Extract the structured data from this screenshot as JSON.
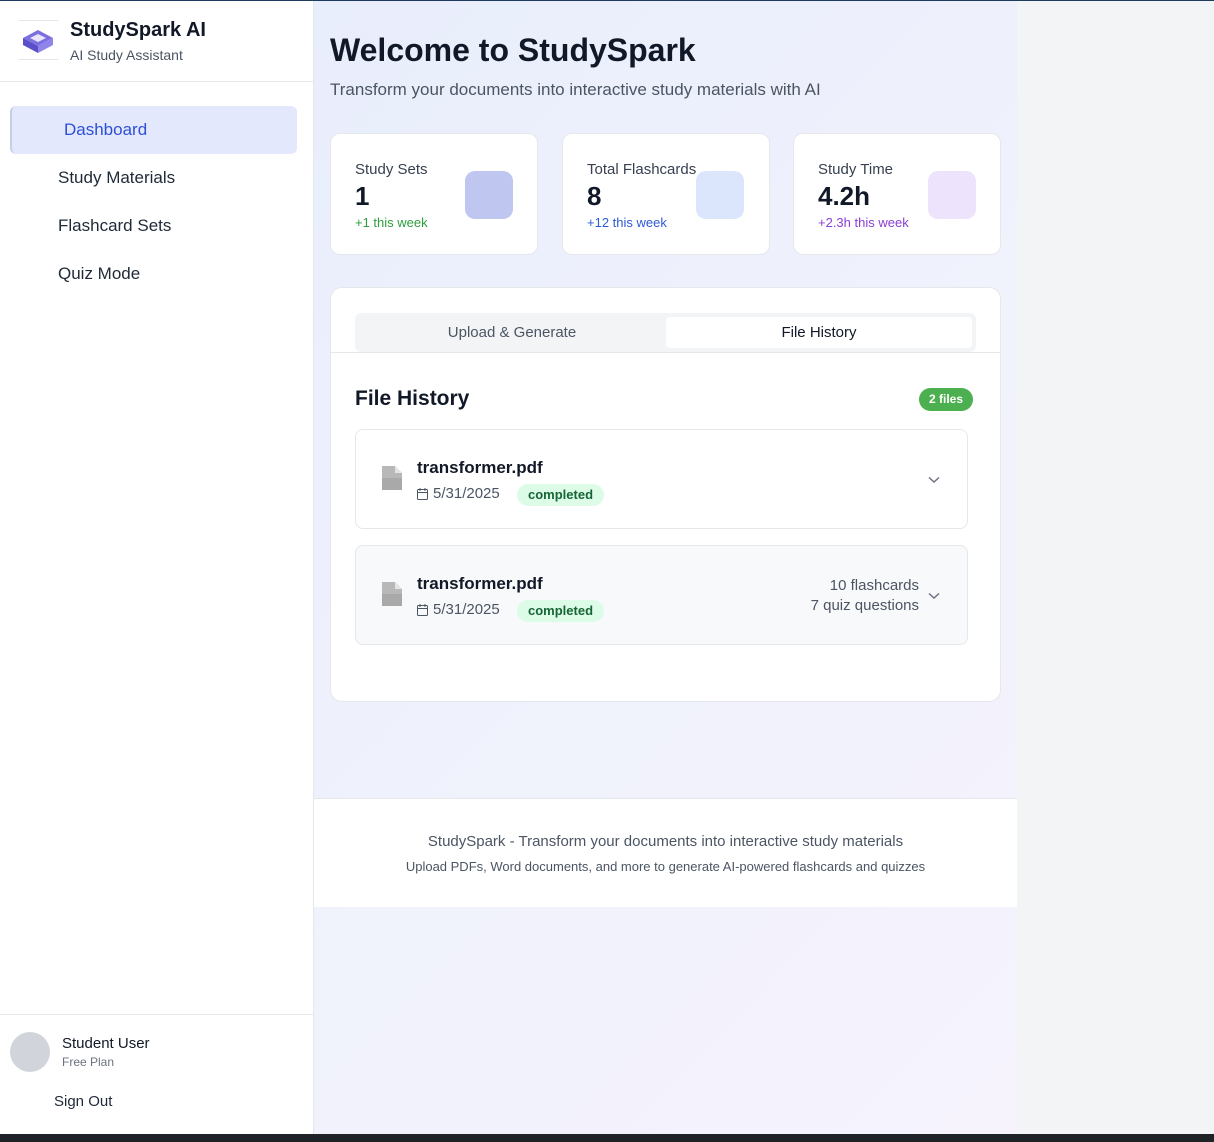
{
  "brand": {
    "title": "StudySpark AI",
    "subtitle": "AI Study Assistant",
    "logo_icon": "layers-icon"
  },
  "nav": {
    "items": [
      {
        "label": "Dashboard",
        "active": true
      },
      {
        "label": "Study Materials",
        "active": false
      },
      {
        "label": "Flashcard Sets",
        "active": false
      },
      {
        "label": "Quiz Mode",
        "active": false
      }
    ]
  },
  "user": {
    "name": "Student User",
    "plan": "Free Plan",
    "sign_out": "Sign Out"
  },
  "header": {
    "title": "Welcome to StudySpark",
    "subtitle": "Transform your documents into interactive study materials with AI"
  },
  "stats": [
    {
      "label": "Study Sets",
      "value": "1",
      "change": "+1 this week",
      "change_color": "#2e9e3e",
      "box_color": "#bfc6f0"
    },
    {
      "label": "Total Flashcards",
      "value": "8",
      "change": "+12 this week",
      "change_color": "#2d5bd6",
      "box_color": "#dbe6fd"
    },
    {
      "label": "Study Time",
      "value": "4.2h",
      "change": "+2.3h this week",
      "change_color": "#8b3fd6",
      "box_color": "#ede3fd"
    }
  ],
  "tabs": {
    "upload": "Upload & Generate",
    "history": "File History",
    "active": "history"
  },
  "file_history": {
    "title": "File History",
    "count_badge": "2 files",
    "files": [
      {
        "name": "transformer.pdf",
        "date": "5/31/2025",
        "status": "completed",
        "flashcards": "",
        "quiz": ""
      },
      {
        "name": "transformer.pdf",
        "date": "5/31/2025",
        "status": "completed",
        "flashcards": "10 flashcards",
        "quiz": "7 quiz questions"
      }
    ]
  },
  "footer": {
    "line1": "StudySpark - Transform your documents into interactive study materials",
    "line2": "Upload PDFs, Word documents, and more to generate AI-powered flashcards and quizzes"
  },
  "colors": {
    "accent": "#2d4fd6",
    "nav_active_bg": "#e3e8fd",
    "badge_green": "#4caf50",
    "status_bg": "#dcfce7"
  }
}
